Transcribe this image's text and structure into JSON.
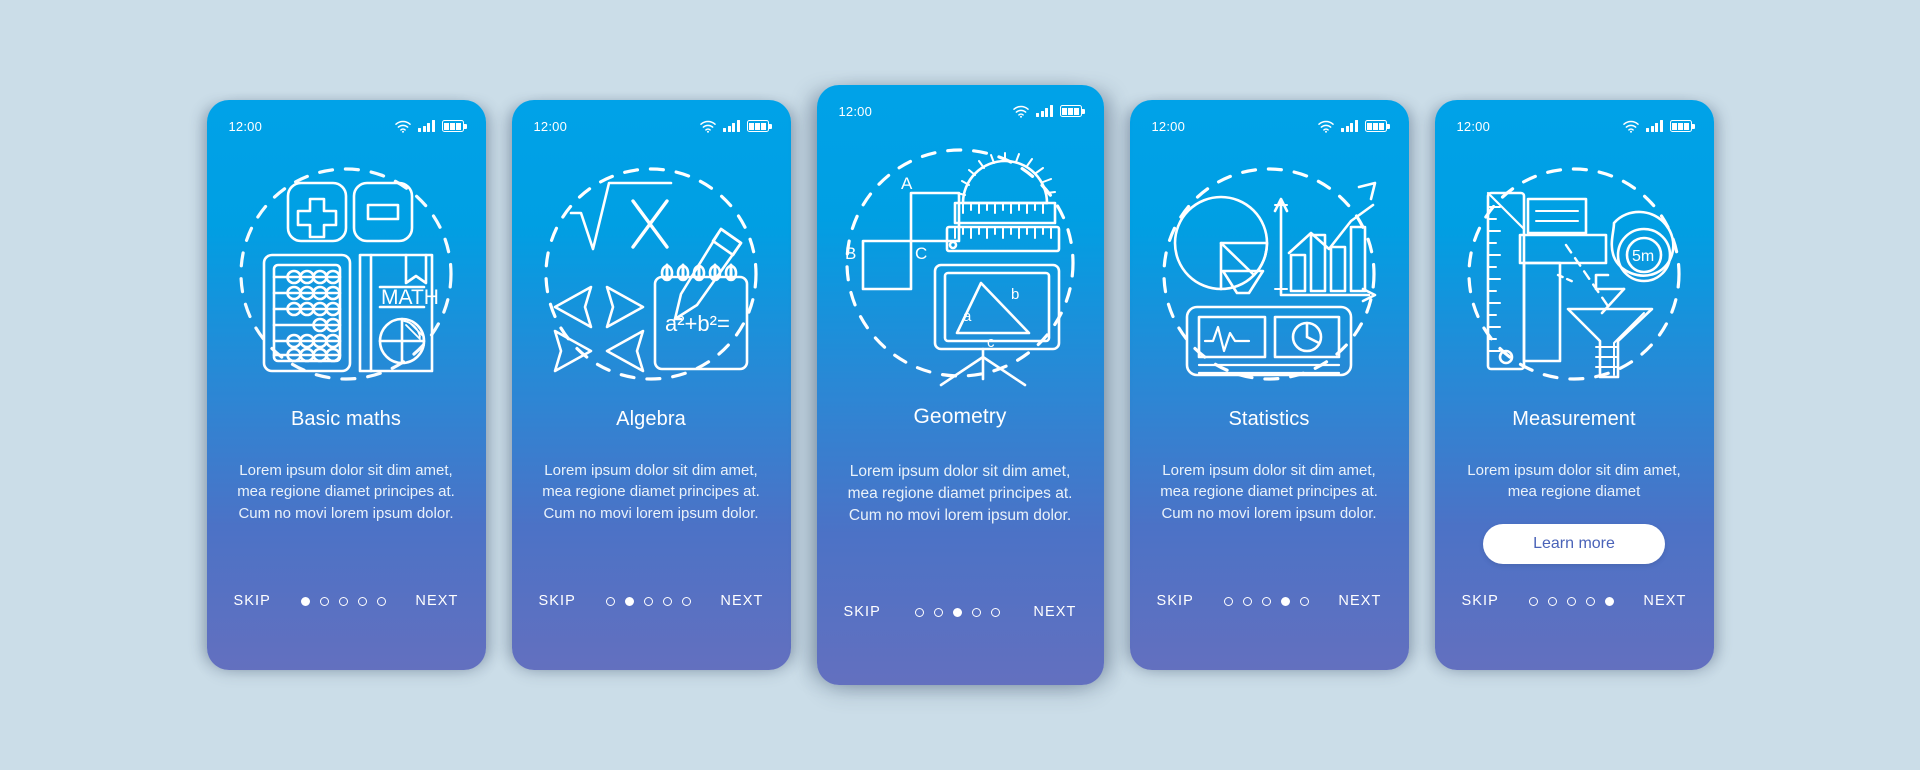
{
  "theme": {
    "page_background": "#cbdde8",
    "card_gradient_top": "#00a2e8",
    "card_gradient_bottom": "#6370bf",
    "line_color": "#ffffff",
    "button_text_color": "#4a63b8"
  },
  "status_bar": {
    "time": "12:00",
    "icons": [
      "wifi-icon",
      "cellular-signal-icon",
      "battery-icon"
    ]
  },
  "nav": {
    "skip_label": "SKIP",
    "next_label": "NEXT",
    "dot_count": 5
  },
  "screens": [
    {
      "id": "basic-maths",
      "title": "Basic maths",
      "description": "Lorem ipsum dolor sit dim amet, mea regione diamet principes at. Cum no movi lorem ipsum dolor.",
      "active_dot": 1,
      "illustration": "abacus-book-plus-minus-icon",
      "illustration_labels": [
        "MATH"
      ],
      "cta": null
    },
    {
      "id": "algebra",
      "title": "Algebra",
      "description": "Lorem ipsum dolor sit dim amet, mea regione diamet principes at. Cum no movi lorem ipsum dolor.",
      "active_dot": 2,
      "illustration": "square-root-notepad-pencil-icon",
      "illustration_labels": [
        "x",
        "a²+b²="
      ],
      "cta": null
    },
    {
      "id": "geometry",
      "title": "Geometry",
      "description": "Lorem ipsum dolor sit dim amet, mea regione diamet principes at. Cum no movi lorem ipsum dolor.",
      "active_dot": 3,
      "illustration": "protractor-ruler-easel-triangle-icon",
      "illustration_labels": [
        "A",
        "B",
        "C",
        "a",
        "b",
        "c"
      ],
      "cta": null
    },
    {
      "id": "statistics",
      "title": "Statistics",
      "description": "Lorem ipsum dolor sit dim amet, mea regione diamet principes at. Cum no movi lorem ipsum dolor.",
      "active_dot": 4,
      "illustration": "pie-chart-bar-graph-dashboard-icon",
      "illustration_labels": [],
      "cta": null
    },
    {
      "id": "measurement",
      "title": "Measurement",
      "description": "Lorem ipsum dolor sit dim amet, mea regione diamet",
      "active_dot": 5,
      "illustration": "ruler-tape-measure-beaker-icon",
      "illustration_labels": [
        "5m"
      ],
      "cta": "Learn more"
    }
  ]
}
